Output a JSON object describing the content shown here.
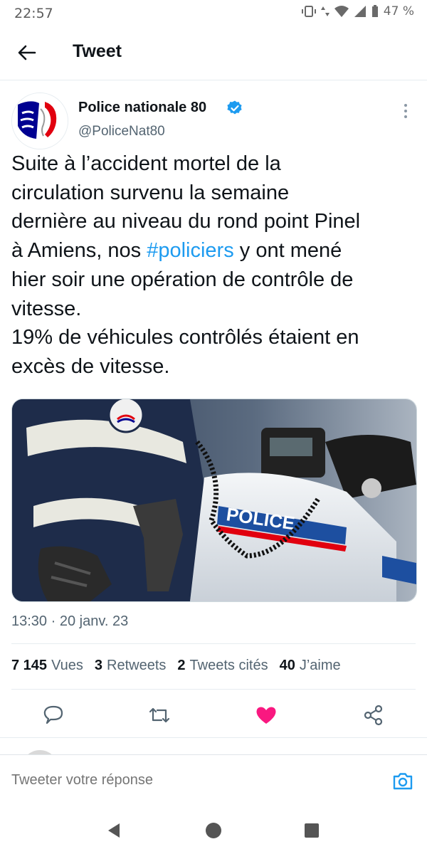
{
  "status_bar": {
    "time": "22:57",
    "battery": "47 %"
  },
  "header": {
    "title": "Tweet"
  },
  "author": {
    "name": "Police nationale 80",
    "handle": "@PoliceNat80"
  },
  "tweet": {
    "text_part1": "Suite à l’accident mortel de la\ncirculation survenu  la semaine\ndernière au niveau du rond point Pinel\nà Amiens, nos ",
    "hashtag": "#policiers",
    "text_part2": " y ont mené\nhier soir une opération de contrôle de\nvitesse.\n19% de véhicules contrôlés étaient en\nexcès de vitesse.",
    "image_text": "POLICE",
    "timestamp": "13:30 · 20 janv. 23"
  },
  "stats": [
    {
      "count": "7 145",
      "label": "Vues"
    },
    {
      "count": "3",
      "label": "Retweets"
    },
    {
      "count": "2",
      "label": "Tweets cités"
    },
    {
      "count": "40",
      "label": "J’aime"
    }
  ],
  "reply": {
    "placeholder": "Tweeter votre réponse"
  },
  "colors": {
    "accent": "#1d9bf0",
    "like": "#f91880",
    "text": "#0f1419",
    "secondary": "#536471"
  },
  "icons": [
    "back-arrow-icon",
    "verified-icon",
    "more-icon",
    "reply-icon",
    "retweet-icon",
    "like-icon",
    "share-icon",
    "camera-icon"
  ]
}
